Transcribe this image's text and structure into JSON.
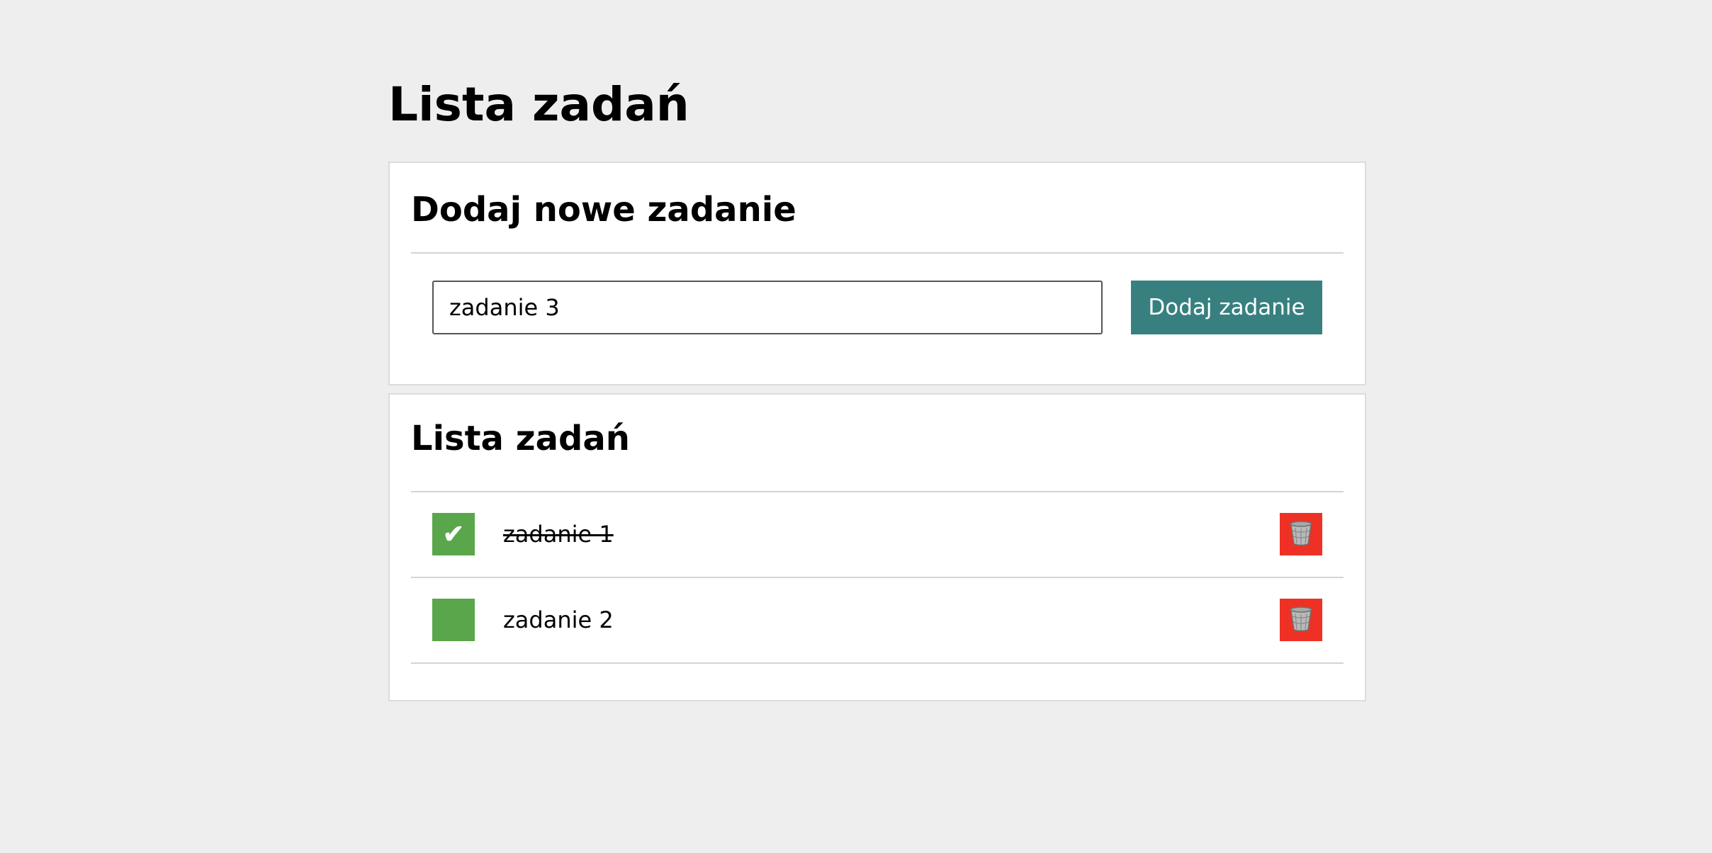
{
  "page": {
    "title": "Lista zadań"
  },
  "add_panel": {
    "heading": "Dodaj nowe zadanie",
    "input_value": "zadanie 3",
    "button_label": "Dodaj zadanie"
  },
  "list_panel": {
    "heading": "Lista zadań",
    "tasks": [
      {
        "text": "zadanie 1",
        "done": true,
        "check_glyph": "✔"
      },
      {
        "text": "zadanie 2",
        "done": false,
        "check_glyph": ""
      }
    ]
  },
  "icons": {
    "check": "check-icon",
    "delete": "trash-icon"
  },
  "colors": {
    "background": "#eeeeee",
    "panel": "#ffffff",
    "add_button": "#388080",
    "check_box": "#5aa64b",
    "delete_button": "#ee3124"
  }
}
